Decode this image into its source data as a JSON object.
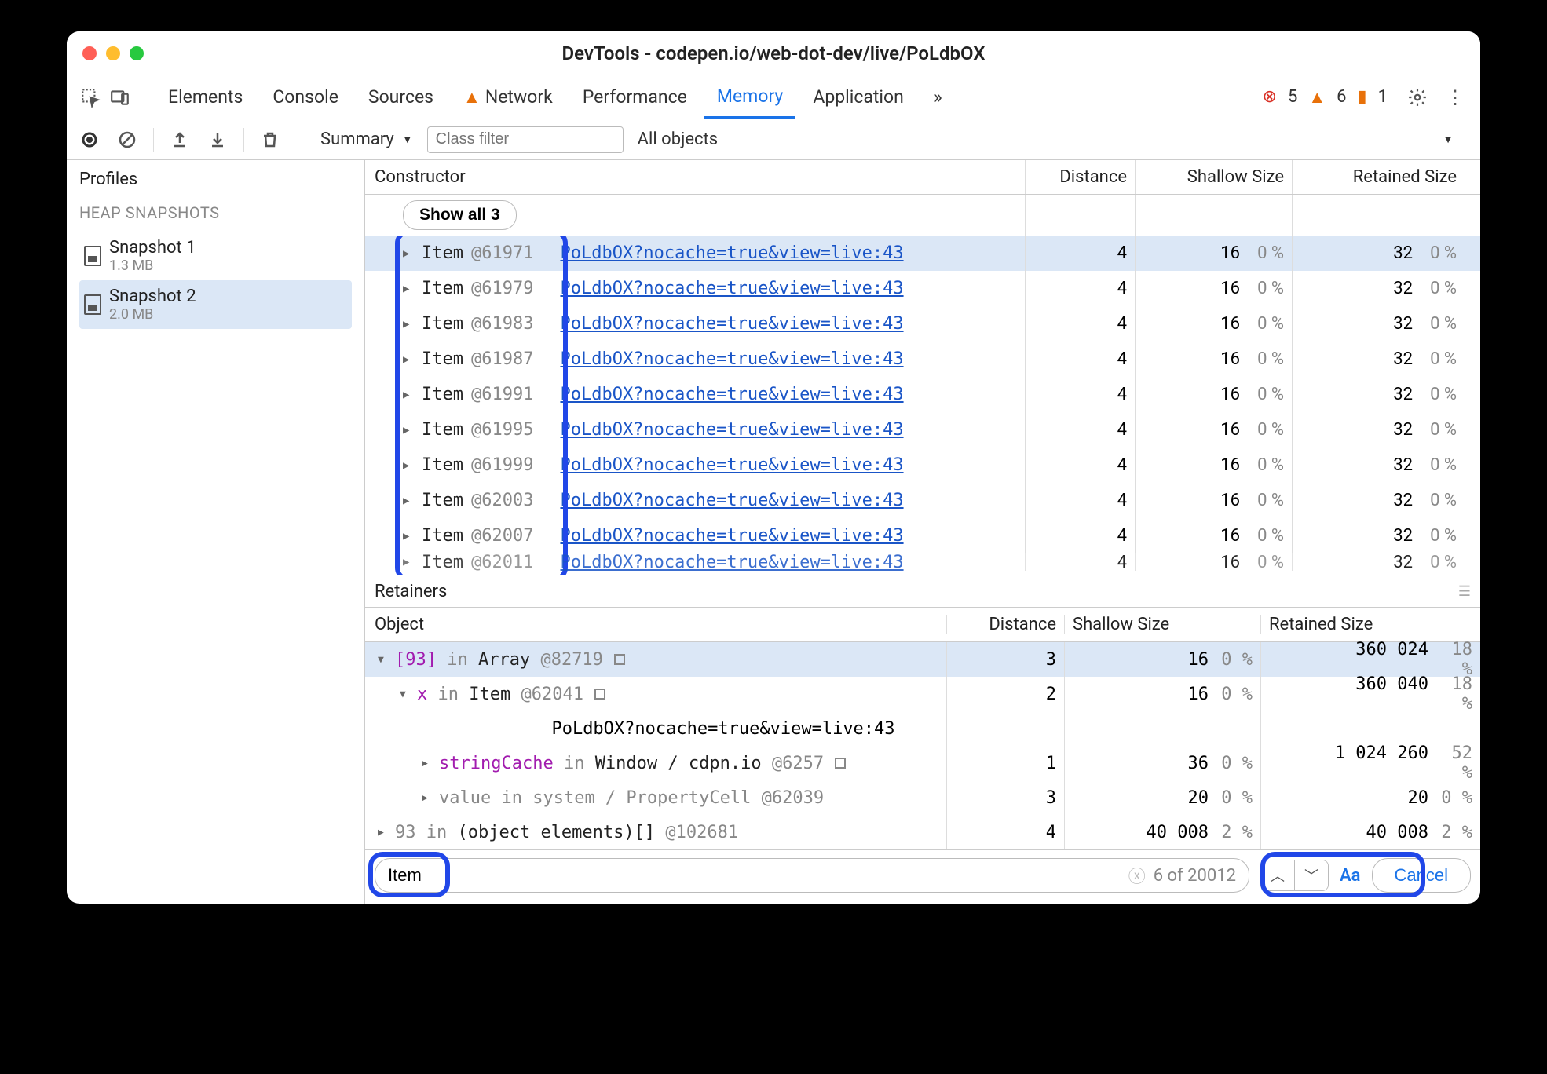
{
  "window_title": "DevTools - codepen.io/web-dot-dev/live/PoLdbOX",
  "tabs": {
    "elements": "Elements",
    "console": "Console",
    "sources": "Sources",
    "network": "Network",
    "performance": "Performance",
    "memory": "Memory",
    "application": "Application",
    "more": "»"
  },
  "badges": {
    "err": "5",
    "warn": "6",
    "msg": "1"
  },
  "toolbar": {
    "summary": "Summary",
    "class_filter_ph": "Class filter",
    "all_objects": "All objects"
  },
  "sidebar": {
    "profiles": "Profiles",
    "section": "HEAP SNAPSHOTS",
    "snapshots": [
      {
        "title": "Snapshot 1",
        "sub": "1.3 MB"
      },
      {
        "title": "Snapshot 2",
        "sub": "2.0 MB"
      }
    ]
  },
  "grid": {
    "headers": {
      "constructor": "Constructor",
      "distance": "Distance",
      "shallow": "Shallow Size",
      "retained": "Retained Size"
    },
    "show_all": "Show all 3",
    "link_text": "PoLdbOX?nocache=true&view=live:43",
    "rows": [
      {
        "label": "Item",
        "id": "@61971",
        "distance": "4",
        "shallow": "16",
        "shallow_pct": "0 %",
        "retained": "32",
        "retained_pct": "0 %",
        "sel": true
      },
      {
        "label": "Item",
        "id": "@61979",
        "distance": "4",
        "shallow": "16",
        "shallow_pct": "0 %",
        "retained": "32",
        "retained_pct": "0 %"
      },
      {
        "label": "Item",
        "id": "@61983",
        "distance": "4",
        "shallow": "16",
        "shallow_pct": "0 %",
        "retained": "32",
        "retained_pct": "0 %"
      },
      {
        "label": "Item",
        "id": "@61987",
        "distance": "4",
        "shallow": "16",
        "shallow_pct": "0 %",
        "retained": "32",
        "retained_pct": "0 %"
      },
      {
        "label": "Item",
        "id": "@61991",
        "distance": "4",
        "shallow": "16",
        "shallow_pct": "0 %",
        "retained": "32",
        "retained_pct": "0 %"
      },
      {
        "label": "Item",
        "id": "@61995",
        "distance": "4",
        "shallow": "16",
        "shallow_pct": "0 %",
        "retained": "32",
        "retained_pct": "0 %"
      },
      {
        "label": "Item",
        "id": "@61999",
        "distance": "4",
        "shallow": "16",
        "shallow_pct": "0 %",
        "retained": "32",
        "retained_pct": "0 %"
      },
      {
        "label": "Item",
        "id": "@62003",
        "distance": "4",
        "shallow": "16",
        "shallow_pct": "0 %",
        "retained": "32",
        "retained_pct": "0 %"
      },
      {
        "label": "Item",
        "id": "@62007",
        "distance": "4",
        "shallow": "16",
        "shallow_pct": "0 %",
        "retained": "32",
        "retained_pct": "0 %"
      },
      {
        "label": "Item",
        "id": "@62011",
        "distance": "4",
        "shallow": "16",
        "shallow_pct": "0 %",
        "retained": "32",
        "retained_pct": "0 %",
        "partial": true
      }
    ]
  },
  "retainers": {
    "title": "Retainers",
    "headers": {
      "object": "Object",
      "distance": "Distance",
      "shallow": "Shallow Size",
      "retained": "Retained Size"
    },
    "rows": [
      {
        "indent": 0,
        "open": true,
        "sel": true,
        "segments": [
          {
            "t": "[93]",
            "c": "prop"
          },
          {
            "t": " in ",
            "c": "kw"
          },
          {
            "t": "Array ",
            "c": "objname"
          },
          {
            "t": "@82719",
            "c": "objid"
          }
        ],
        "boxicon": true,
        "distance": "3",
        "shallow": "16",
        "shallow_pct": "0 %",
        "retained": "360 024",
        "retained_pct": "18 %"
      },
      {
        "indent": 1,
        "open": true,
        "segments": [
          {
            "t": "x",
            "c": "prop"
          },
          {
            "t": " in ",
            "c": "kw"
          },
          {
            "t": "Item ",
            "c": "objname"
          },
          {
            "t": "@62041",
            "c": "objid"
          }
        ],
        "boxicon": true,
        "distance": "2",
        "shallow": "16",
        "shallow_pct": "0 %",
        "retained": "360 040",
        "retained_pct": "18 %"
      },
      {
        "indent": 0,
        "linkonly": true,
        "link": "PoLdbOX?nocache=true&view=live:43"
      },
      {
        "indent": 2,
        "closed": true,
        "segments": [
          {
            "t": "stringCache",
            "c": "prop"
          },
          {
            "t": " in ",
            "c": "kw"
          },
          {
            "t": "Window / cdpn.io ",
            "c": "objname"
          },
          {
            "t": "@6257",
            "c": "objid"
          }
        ],
        "boxicon": true,
        "distance": "1",
        "shallow": "36",
        "shallow_pct": "0 %",
        "retained": "1 024 260",
        "retained_pct": "52 %"
      },
      {
        "indent": 2,
        "closed": true,
        "segments": [
          {
            "t": "value",
            "c": "kw"
          },
          {
            "t": " in ",
            "c": "kw"
          },
          {
            "t": "system / PropertyCell ",
            "c": "kw"
          },
          {
            "t": "@62039",
            "c": "kw"
          }
        ],
        "distance": "3",
        "shallow": "20",
        "shallow_pct": "0 %",
        "retained": "20",
        "retained_pct": "0 %"
      },
      {
        "indent": 0,
        "closed": true,
        "segments": [
          {
            "t": "93",
            "c": "kw"
          },
          {
            "t": " in ",
            "c": "kw"
          },
          {
            "t": "(object elements)[] ",
            "c": "objname"
          },
          {
            "t": "@102681",
            "c": "objid"
          }
        ],
        "distance": "4",
        "shallow": "40 008",
        "shallow_pct": "2 %",
        "retained": "40 008",
        "retained_pct": "2 %"
      }
    ]
  },
  "find": {
    "value": "Item",
    "count": "6 of 20012",
    "aa": "Aa",
    "cancel": "Cancel"
  }
}
